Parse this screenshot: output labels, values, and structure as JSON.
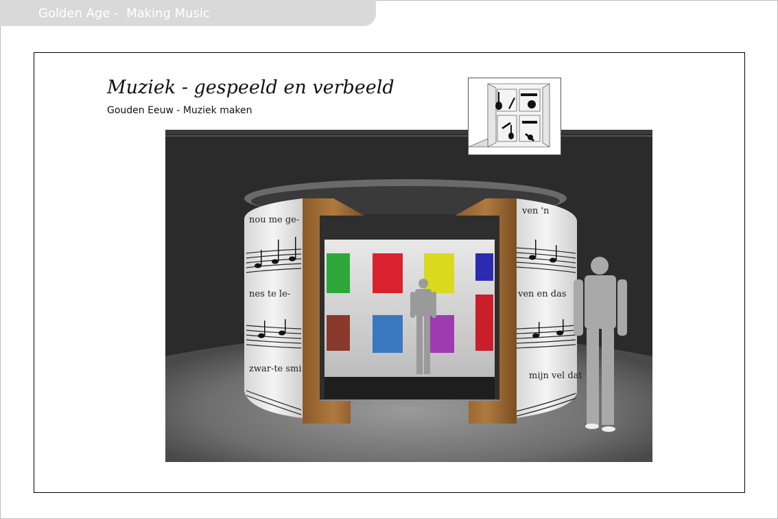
{
  "header": {
    "title": "Golden Age -  Making Music"
  },
  "document": {
    "title": "Muziek - gespeeld en verbeeld",
    "subtitle": "Gouden Eeuw - Muziek maken"
  },
  "rendering": {
    "lyrics_left_top": "nou me ge-",
    "lyrics_left_mid": "nes te le-",
    "lyrics_left_bottom": "zwar-te smi",
    "lyrics_right_top": "ven 'n",
    "lyrics_right_mid": "ven  en  das",
    "lyrics_right_bottom": "mijn   vel dat",
    "panel_colors": [
      "#2fa83a",
      "#d8232e",
      "#d9d91e",
      "#2b2bb0",
      "#8a3a2a",
      "#3a78c0",
      "#a03ab0",
      "#c81f2a"
    ]
  }
}
